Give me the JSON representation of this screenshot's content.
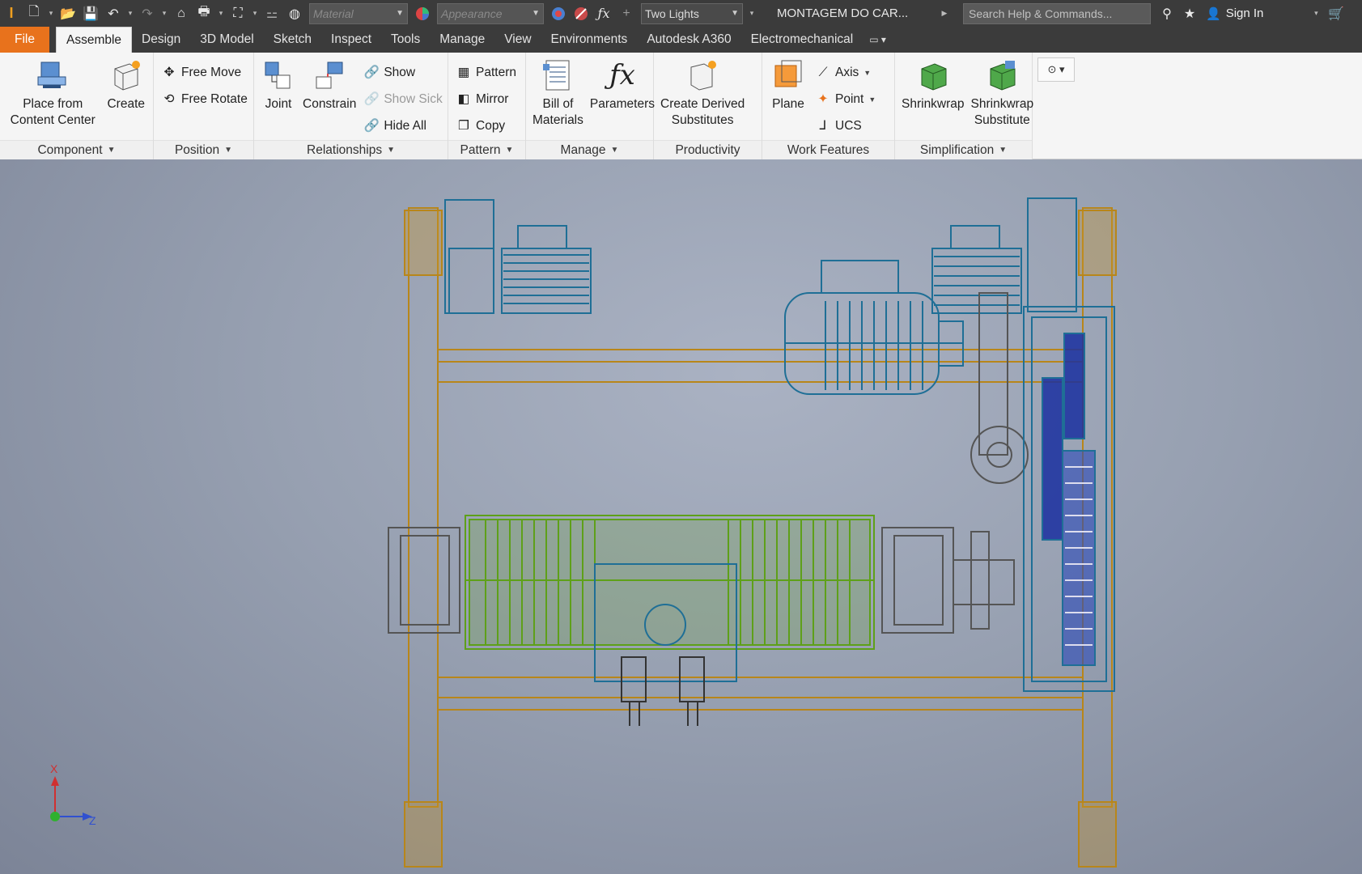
{
  "qat": {
    "logo": "I",
    "material_placeholder": "Material",
    "appearance_placeholder": "Appearance",
    "lighting": "Two Lights",
    "document_title": "MONTAGEM DO CAR...",
    "search_placeholder": "Search Help & Commands...",
    "sign_in": "Sign In"
  },
  "tabs": [
    "File",
    "Assemble",
    "Design",
    "3D Model",
    "Sketch",
    "Inspect",
    "Tools",
    "Manage",
    "View",
    "Environments",
    "Autodesk A360",
    "Electromechanical"
  ],
  "ribbon": {
    "component": {
      "label": "Component",
      "place": "Place from\nContent Center",
      "create": "Create"
    },
    "position": {
      "label": "Position",
      "free_move": "Free Move",
      "free_rotate": "Free Rotate"
    },
    "relationships": {
      "label": "Relationships",
      "joint": "Joint",
      "constrain": "Constrain",
      "show": "Show",
      "show_sick": "Show Sick",
      "hide_all": "Hide All"
    },
    "pattern": {
      "label": "Pattern",
      "pattern": "Pattern",
      "mirror": "Mirror",
      "copy": "Copy"
    },
    "manage": {
      "label": "Manage",
      "bom": "Bill of\nMaterials",
      "parameters": "Parameters"
    },
    "productivity": {
      "label": "Productivity",
      "derived": "Create Derived\nSubstitutes"
    },
    "work_features": {
      "label": "Work Features",
      "plane": "Plane",
      "axis": "Axis",
      "point": "Point",
      "ucs": "UCS"
    },
    "simplification": {
      "label": "Simplification",
      "shrinkwrap": "Shrinkwrap",
      "shrinkwrap_sub": "Shrinkwrap\nSubstitute"
    }
  },
  "axes": {
    "x": "X",
    "z": "Z"
  },
  "colors": {
    "file_tab": "#e8721c",
    "frame": "#b8861a",
    "motor": "#1f6f96",
    "drum": "#5ea019",
    "gear": "#1a2fa0"
  }
}
